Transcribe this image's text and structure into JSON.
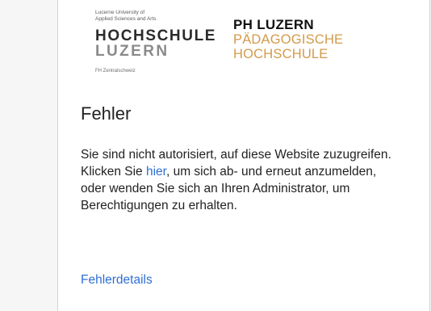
{
  "logos": {
    "hslu": {
      "line1": "Lucerne University of",
      "line2": "Applied Sciences and Arts",
      "name1": "HOCHSCHULE",
      "name2": "LUZERN",
      "footer": "FH Zentralschweiz"
    },
    "ph": {
      "line1": "PH LUZERN",
      "line2": "PÄDAGOGISCHE",
      "line3": "HOCHSCHULE"
    }
  },
  "error": {
    "title": "Fehler",
    "message_part1": "Sie sind nicht autorisiert, auf diese Website zuzugreifen. Klicken Sie ",
    "link_text": "hier",
    "message_part2": ", um sich ab- und erneut anzumelden, oder wenden Sie sich an Ihren Administrator, um Berechtigungen zu erhalten.",
    "details_link": "Fehlerdetails"
  },
  "colors": {
    "link": "#2f6fd6",
    "ph_accent": "#d39a4a",
    "text": "#222222"
  }
}
